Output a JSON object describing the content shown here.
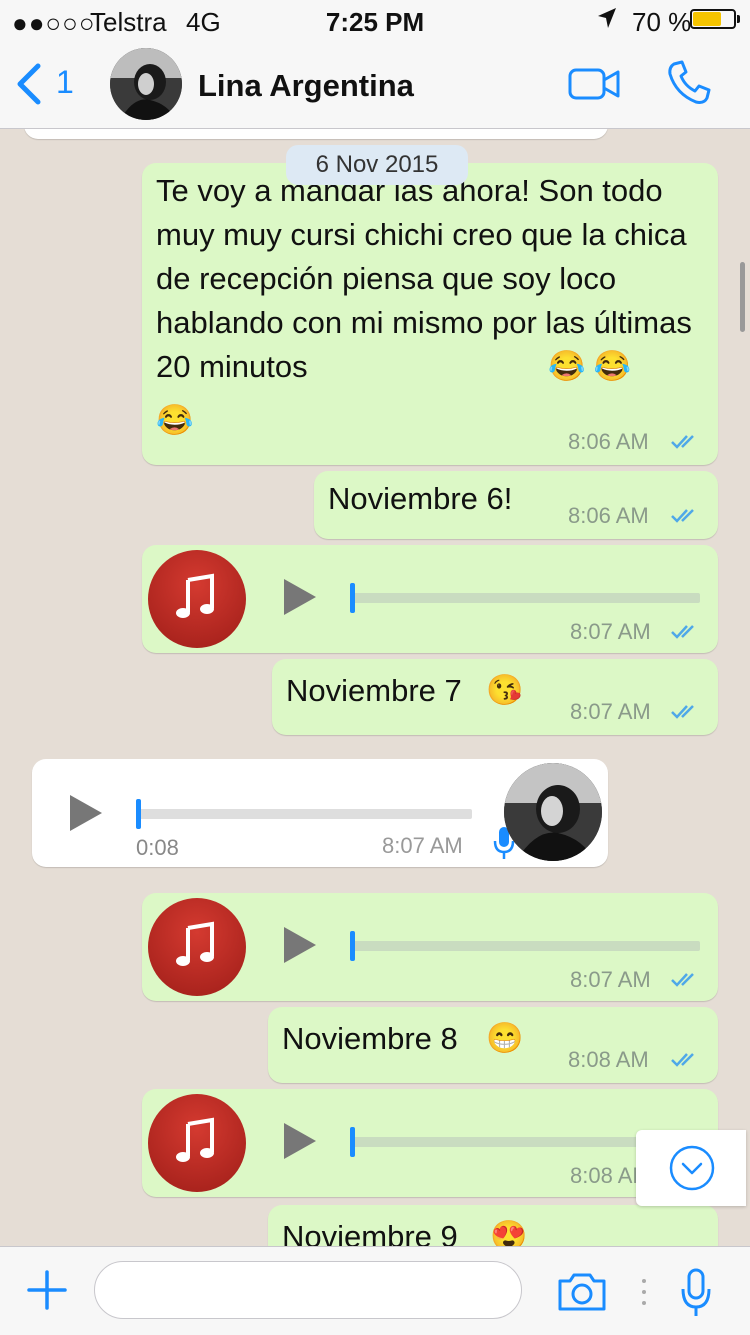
{
  "status_bar": {
    "signal": "●●○○○",
    "carrier": "Telstra",
    "network": "4G",
    "time": "7:25 PM",
    "battery": "70 %"
  },
  "header": {
    "back_count": "1",
    "contact_name": "Lina Argentina"
  },
  "chat": {
    "date_label": "6 Nov 2015",
    "messages": [
      {
        "type": "text",
        "direction": "out",
        "text": "Te voy a mandar las ahora! Son todo muy muy cursi chichi creo que la chica de recepción piensa que soy loco hablando con mi mismo por las últimas 20 minutos",
        "emoji": "😂 😂",
        "emoji2": "😂",
        "time": "8:06 AM"
      },
      {
        "type": "text",
        "direction": "out",
        "text": "Noviembre 6!",
        "time": "8:06 AM"
      },
      {
        "type": "audio",
        "direction": "out",
        "time": "8:07 AM"
      },
      {
        "type": "text",
        "direction": "out",
        "text": "Noviembre 7",
        "emoji": "😘",
        "time": "8:07 AM"
      },
      {
        "type": "voice",
        "direction": "in",
        "duration": "0:08",
        "time": "8:07 AM"
      },
      {
        "type": "audio",
        "direction": "out",
        "time": "8:07 AM"
      },
      {
        "type": "text",
        "direction": "out",
        "text": "Noviembre 8",
        "emoji": "😁",
        "time": "8:08 AM"
      },
      {
        "type": "audio",
        "direction": "out",
        "time": "8:08 AM"
      },
      {
        "type": "text",
        "direction": "out",
        "text": "Noviembre 9",
        "emoji": "😍"
      }
    ]
  },
  "composer": {
    "placeholder": ""
  },
  "colors": {
    "accent": "#1a8cff",
    "outgoing_bubble": "#dcf8c6",
    "incoming_bubble": "#ffffff",
    "chat_background": "#e5ddd5",
    "read_ticks": "#4fa8e8"
  }
}
